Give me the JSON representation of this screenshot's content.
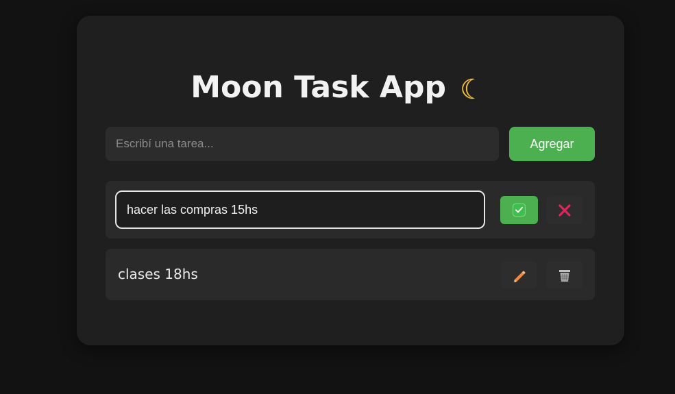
{
  "app": {
    "title": "Moon Task App",
    "title_icon": "moon-icon"
  },
  "new_task": {
    "placeholder": "Escribí una tarea...",
    "value": "",
    "add_label": "Agregar"
  },
  "tasks": [
    {
      "text": "hacer las compras 15hs",
      "state": "editing",
      "actions": [
        "check-icon",
        "close-icon"
      ]
    },
    {
      "text": "clases 18hs",
      "state": "normal",
      "actions": [
        "pencil-icon",
        "trash-icon"
      ]
    }
  ],
  "colors": {
    "background": "#121212",
    "card": "#1f1f1f",
    "accent": "#4caf50",
    "danger": "#e0245e",
    "pencil": "#f5883b"
  }
}
